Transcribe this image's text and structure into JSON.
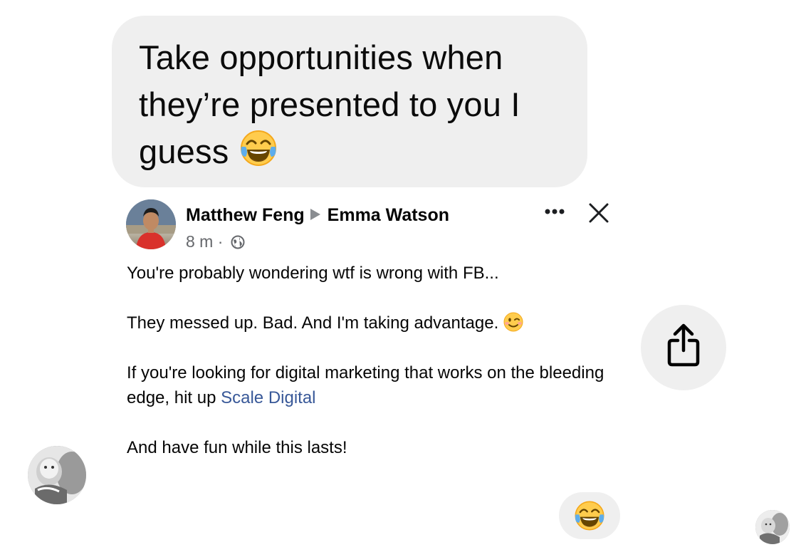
{
  "message": {
    "text": "Take opportunities when they’re presented to you I guess",
    "emoji": "face-with-tears-of-joy"
  },
  "shared_post": {
    "author": "Matthew Feng",
    "target": "Emma Watson",
    "time": "8 m",
    "separator": "·",
    "privacy_icon": "globe-icon",
    "paragraphs": [
      "You're probably wondering wtf is wrong with FB...",
      "They messed up. Bad. And I'm taking advantage.",
      "If you're looking for digital marketing that works on the bleeding edge, hit up",
      "And have fun while this lasts!"
    ],
    "link_text": "Scale Digital",
    "wink_emoji": "winking-face"
  },
  "reaction": {
    "emoji": "face-with-tears-of-joy"
  },
  "colors": {
    "bubble_bg": "#efefef",
    "link": "#385898",
    "secondary_text": "#65676b"
  }
}
